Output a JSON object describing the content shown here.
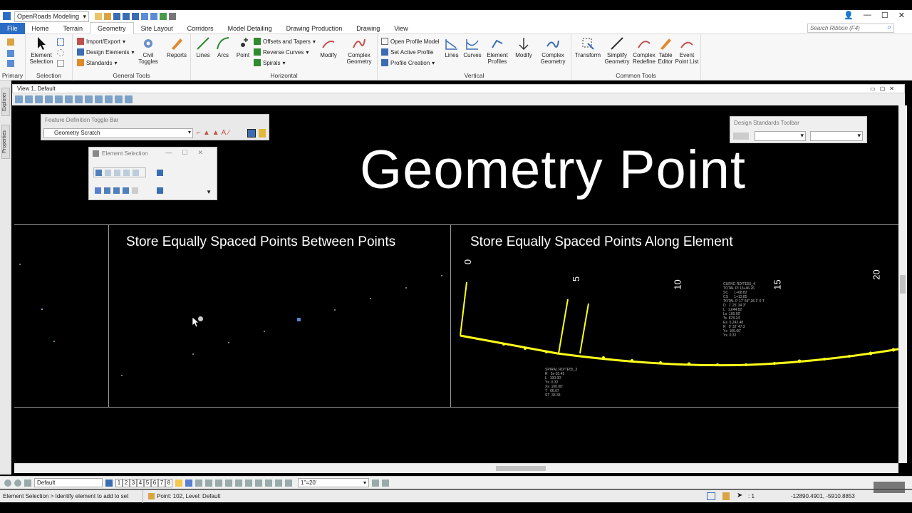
{
  "app": {
    "workspace": "OpenRoads Modeling",
    "search_placeholder": "Search Ribbon (F4)"
  },
  "tabs": [
    "File",
    "Home",
    "Terrain",
    "Geometry",
    "Site Layout",
    "Corridors",
    "Model Detailing",
    "Drawing Production",
    "Drawing",
    "View"
  ],
  "ribbon": {
    "primary": "Primary",
    "selection": {
      "label": "Selection",
      "element_selection": "Element\nSelection"
    },
    "general_tools": {
      "label": "General Tools",
      "import_export": "Import/Export",
      "design_elements": "Design Elements",
      "standards": "Standards",
      "civil_toggles": "Civil\nToggles",
      "reports": "Reports"
    },
    "horizontal": {
      "label": "Horizontal",
      "lines": "Lines",
      "arcs": "Arcs",
      "point": "Point",
      "offsets_tapers": "Offsets and Tapers",
      "reverse_curves": "Reverse Curves",
      "spirals": "Spirals",
      "modify": "Modify",
      "complex_geometry": "Complex\nGeometry"
    },
    "vertical": {
      "label": "Vertical",
      "open_profile_model": "Open Profile Model",
      "set_active_profile": "Set Active Profile",
      "profile_creation": "Profile Creation",
      "lines": "Lines",
      "curves": "Curves",
      "element_profiles": "Element\nProfiles",
      "modify": "Modify",
      "complex_geometry": "Complex\nGeometry"
    },
    "common_tools": {
      "label": "Common Tools",
      "transform": "Transform",
      "simplify_geometry": "Simplify\nGeometry",
      "complex_redefine": "Complex\nRedefine",
      "table_editor": "Table\nEditor",
      "event_point_list": "Event\nPoint List"
    }
  },
  "sidebar": {
    "explorer": "Explorer",
    "properties": "Properties"
  },
  "view": {
    "title": "View 1, Default"
  },
  "canvas": {
    "title": "Geometry Point",
    "section_left": "Store Equally Spaced Points  Between Points",
    "section_right": "Store Equally Spaced Points  Along Element",
    "stations": [
      "0",
      "5",
      "10",
      "15",
      "20"
    ],
    "annotation_curve": "CURVE RD/TE55_4\nTOTAL PI 13+46.26\nSC      1+68.82\nCS      1+13.85\nTOTAL 0' 17' 59\",36.1' 0 T\nD   1' 25' 34.3\"\nL   1,644.82\nLs  100.00'\nTs  878.24'\nEs  5,242.48\nR   0' 32' 47.3\nYs  100.00'\nYs  0.32",
    "annotation_spiral": "SPIRAL RD/TE55_3\nR   5x-33.45\nL   100.00'\nYs  0.32\nXs  100.00'\nT   66.67\nST  33.33"
  },
  "toolbars": {
    "feature_definition": {
      "title": "Feature Definition Toggle Bar",
      "value": "Geometry Scratch"
    },
    "element_selection": {
      "title": "Element Selection"
    },
    "design_standards": {
      "title": "Design Standards Toolbar"
    }
  },
  "bottombar": {
    "level": "Default",
    "views": [
      "1",
      "2",
      "3",
      "4",
      "5",
      "6",
      "7",
      "8"
    ],
    "scale": "1\"=20'"
  },
  "status": {
    "left": "Element Selection > Identify element to add to set",
    "mid": "Point: 102, Level: Default",
    "count": ": 1",
    "coords": "-12890.4901, -5910.8853"
  }
}
